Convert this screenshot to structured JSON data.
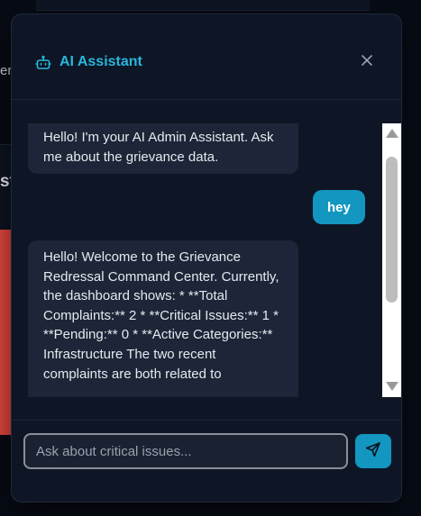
{
  "background": {
    "fragment_left": "er",
    "fragment_heading": "st"
  },
  "assistant": {
    "title": "AI Assistant",
    "icons": {
      "title_icon": "bot-icon",
      "close": "close-icon",
      "send": "send-icon"
    },
    "messages": [
      {
        "role": "assistant",
        "text": "Hello! I'm your AI Admin Assistant. Ask me about the grievance data."
      },
      {
        "role": "user",
        "text": "hey"
      },
      {
        "role": "assistant",
        "text": "Hello! Welcome to the Grievance Redressal Command Center. Currently, the dashboard shows: * **Total Complaints:** 2 * **Critical Issues:** 1 * **Pending:** 0 * **Active Categories:** Infrastructure The two recent complaints are both related to"
      }
    ],
    "input": {
      "value": "",
      "placeholder": "Ask about critical issues..."
    }
  },
  "colors": {
    "accent": "#1396c0",
    "title": "#29b6db",
    "dialog_bg": "#0e1626",
    "bubble_bg": "#1c2638",
    "alert_red": "#e0453b"
  }
}
